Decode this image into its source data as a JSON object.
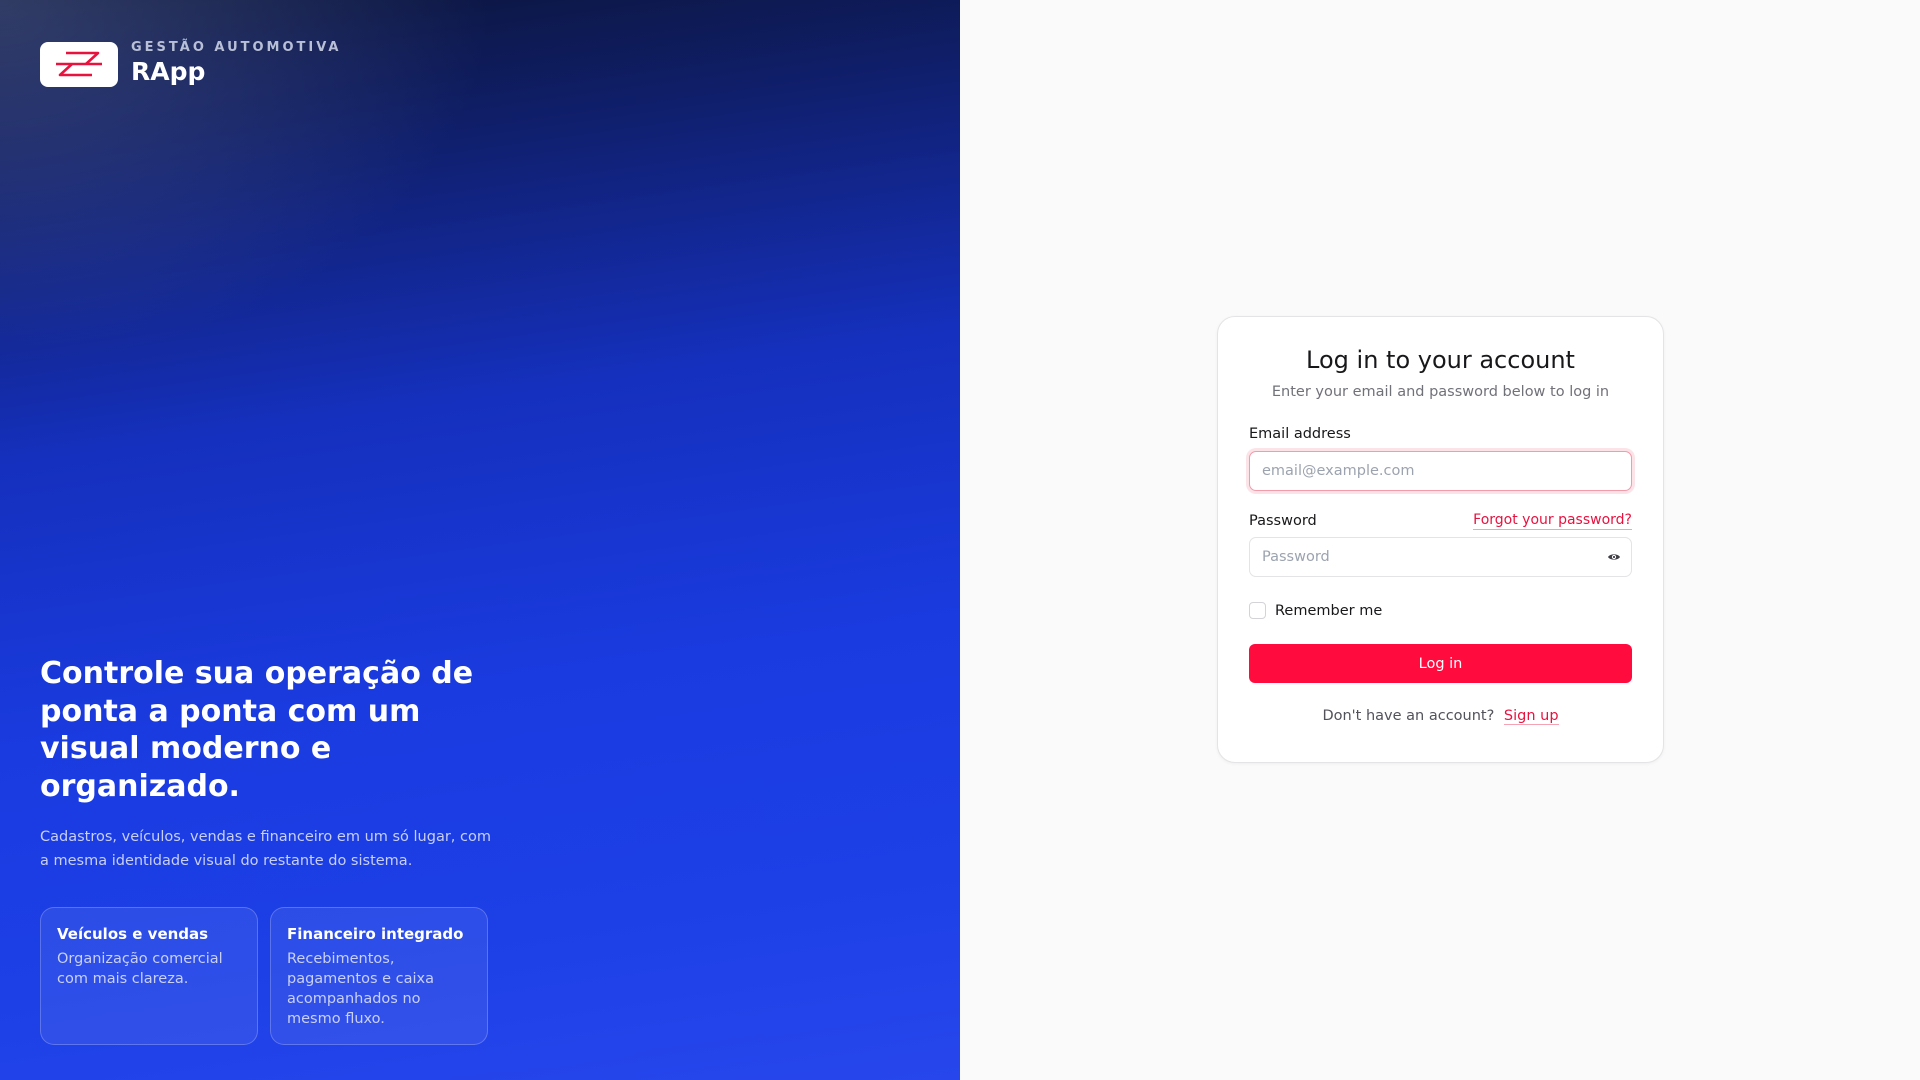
{
  "brand": {
    "eyebrow": "GESTÃO AUTOMOTIVA",
    "name": "RApp",
    "logo_icon": "rapp-logo-icon",
    "accent_color": "#e8123f"
  },
  "hero": {
    "heading": "Controle sua operação de ponta a ponta com um visual moderno e organizado.",
    "subheading": "Cadastros, veículos, vendas e financeiro em um só lugar, com a mesma identidade visual do restante do sistema.",
    "features": [
      {
        "title": "Veículos e vendas",
        "description": "Organização comercial com mais clareza."
      },
      {
        "title": "Financeiro integrado",
        "description": "Recebimentos, pagamentos e caixa acompanhados no mesmo fluxo."
      }
    ]
  },
  "login": {
    "title": "Log in to your account",
    "subtitle": "Enter your email and password below to log in",
    "email_label": "Email address",
    "email_value": "",
    "email_placeholder": "email@example.com",
    "password_label": "Password",
    "password_value": "",
    "password_placeholder": "Password",
    "forgot_label": "Forgot your password?",
    "show_password_icon": "eye-icon",
    "remember_label": "Remember me",
    "remember_checked": false,
    "submit_label": "Log in",
    "submit_color": "#ff0b3e",
    "signup_prompt": "Don't have an account?",
    "signup_label": "Sign up"
  }
}
